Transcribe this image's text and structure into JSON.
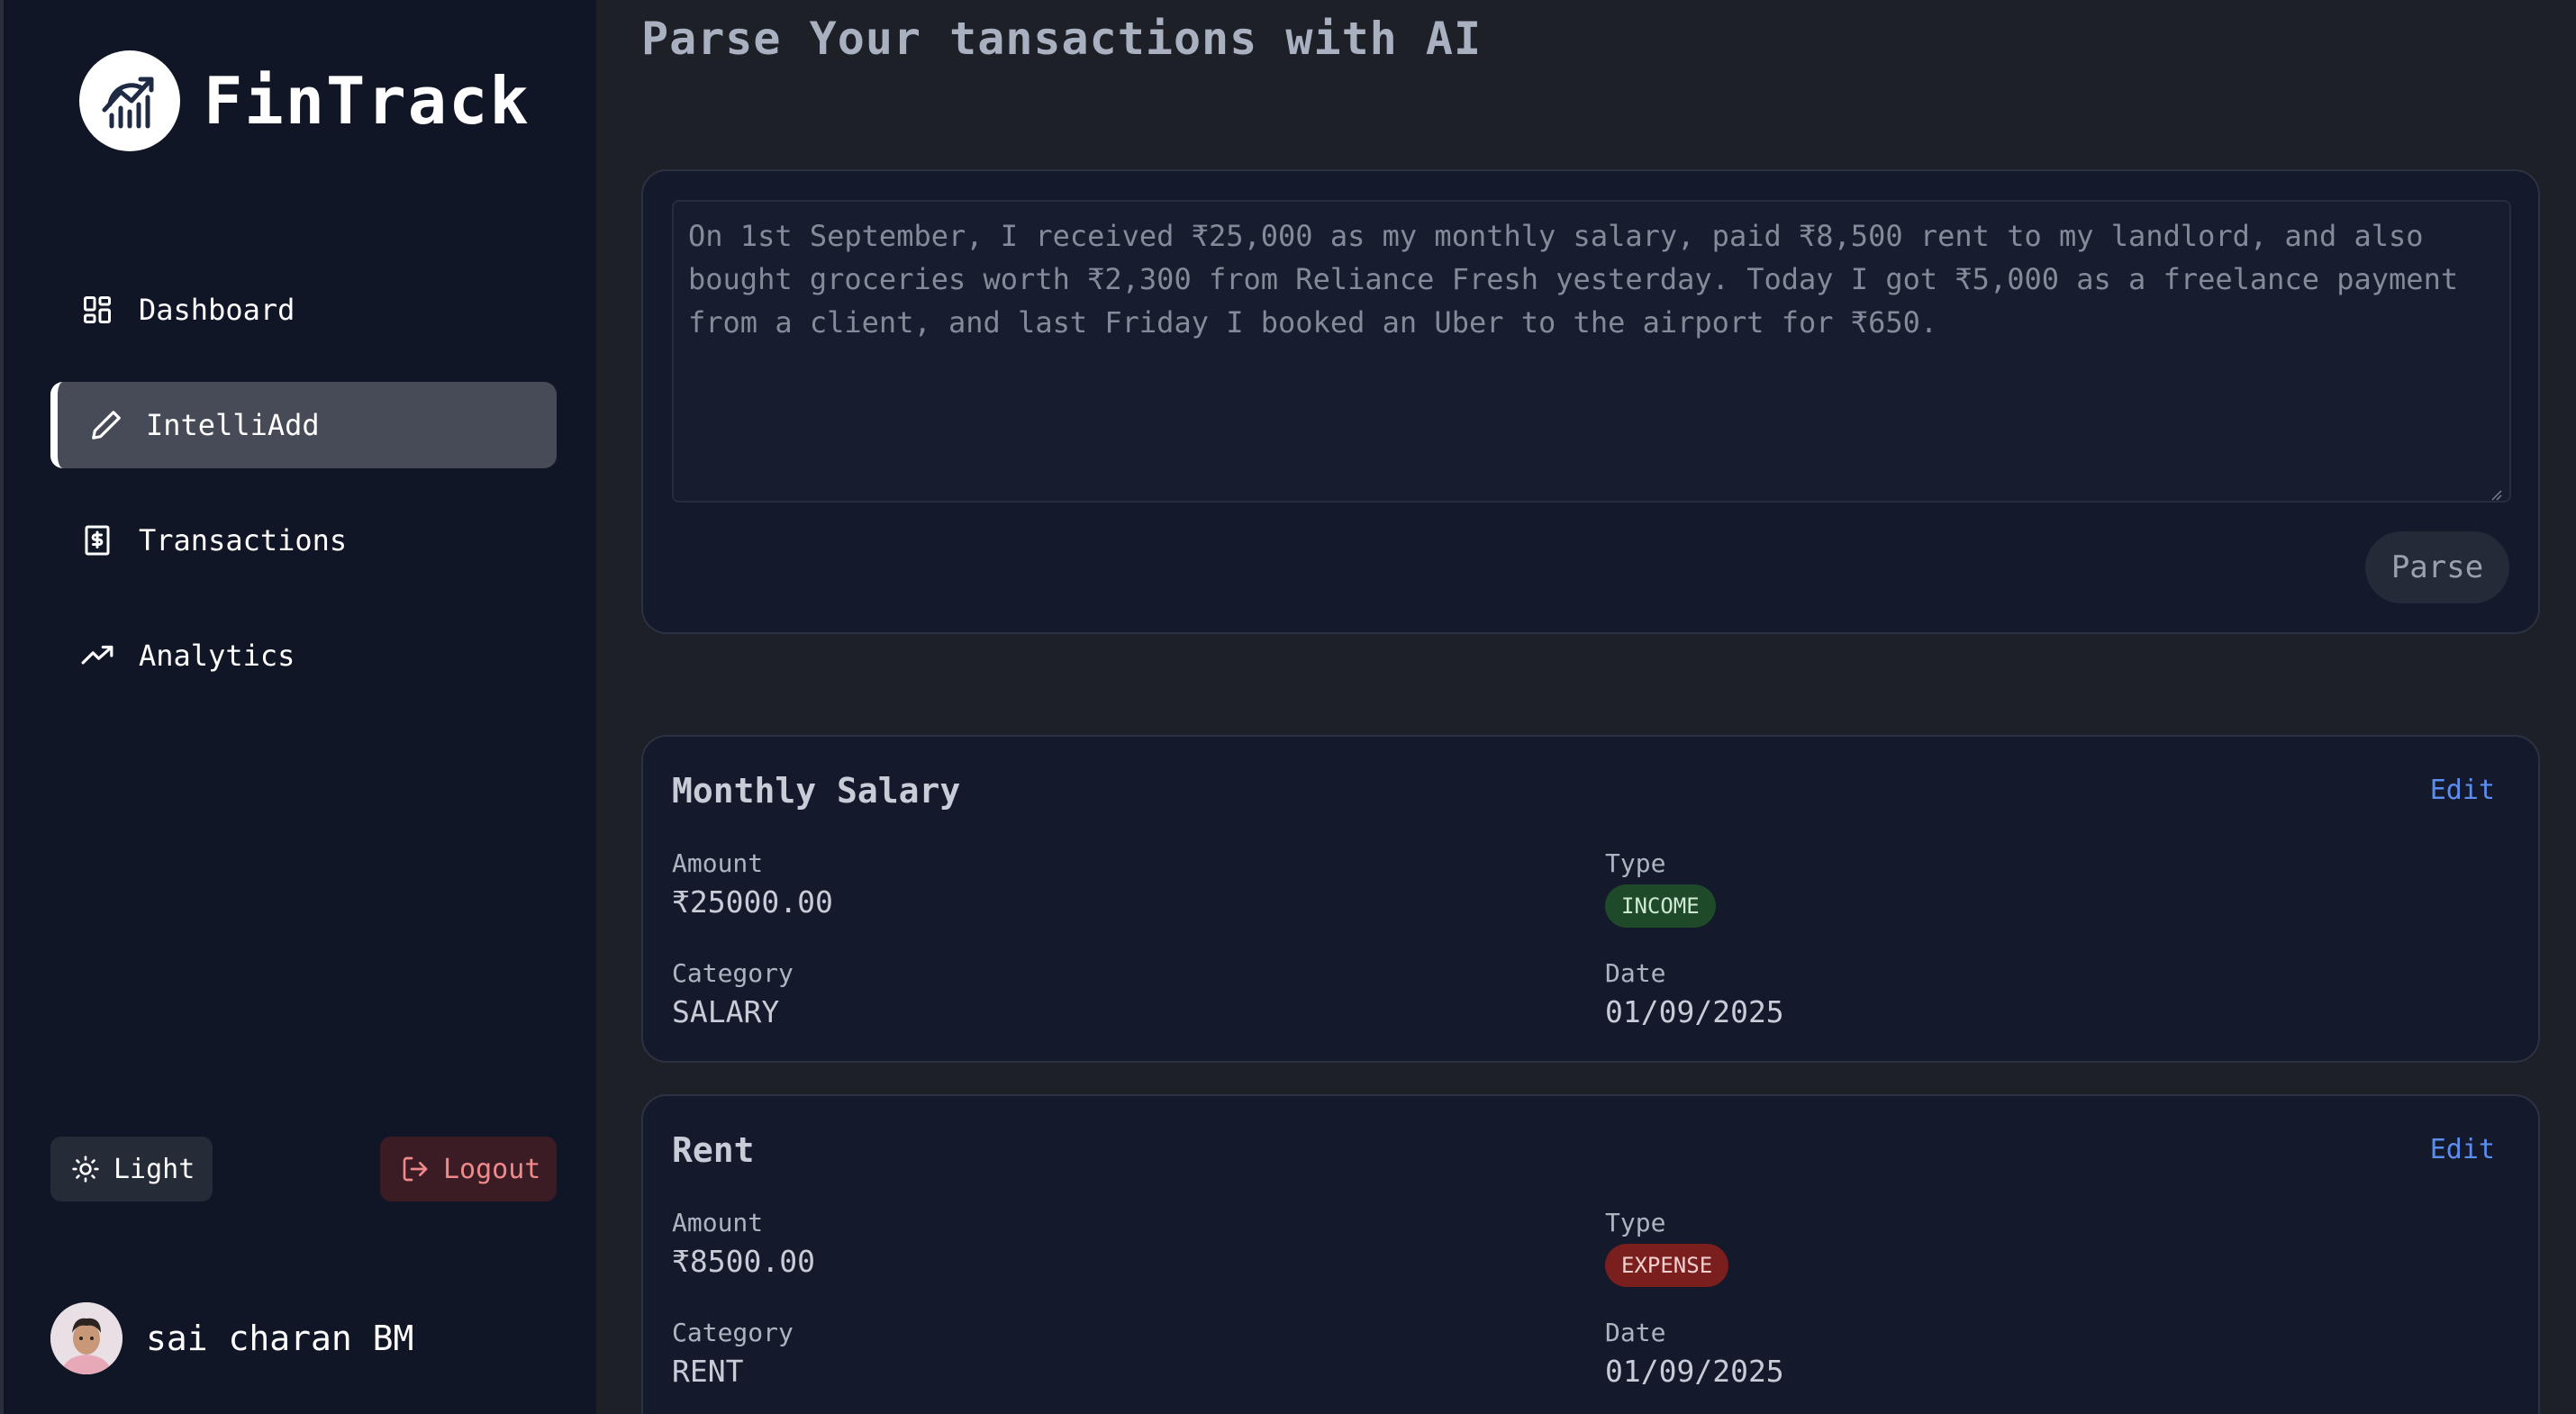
{
  "brand": {
    "name": "FinTrack",
    "logo_icon": "chart-logo-icon"
  },
  "nav": {
    "items": [
      {
        "label": "Dashboard",
        "icon": "dashboard-icon",
        "active": false
      },
      {
        "label": "IntelliAdd",
        "icon": "pencil-icon",
        "active": true
      },
      {
        "label": "Transactions",
        "icon": "receipt-icon",
        "active": false
      },
      {
        "label": "Analytics",
        "icon": "trending-up-icon",
        "active": false
      }
    ]
  },
  "footer": {
    "theme_label": "Light",
    "logout_label": "Logout",
    "user_name": "sai charan BM"
  },
  "main": {
    "title": "Parse Your tansactions with AI",
    "input_text": "On 1st September, I received ₹25,000 as my monthly salary, paid ₹8,500 rent to my landlord, and also bought groceries worth ₹2,300 from Reliance Fresh yesterday. Today I got ₹5,000 as a freelance payment from a client, and last Friday I booked an Uber to the airport for ₹650.",
    "parse_label": "Parse"
  },
  "field_labels": {
    "amount": "Amount",
    "type": "Type",
    "category": "Category",
    "date": "Date",
    "edit": "Edit"
  },
  "transactions": [
    {
      "title": "Monthly Salary",
      "amount": "₹25000.00",
      "type": "INCOME",
      "category": "SALARY",
      "date": "01/09/2025"
    },
    {
      "title": "Rent",
      "amount": "₹8500.00",
      "type": "EXPENSE",
      "category": "RENT",
      "date": "01/09/2025"
    }
  ],
  "colors": {
    "accent": "#5c8ef0",
    "income": "#1f4a2a",
    "expense": "#7a1e1e",
    "sidebar": "#111627"
  }
}
